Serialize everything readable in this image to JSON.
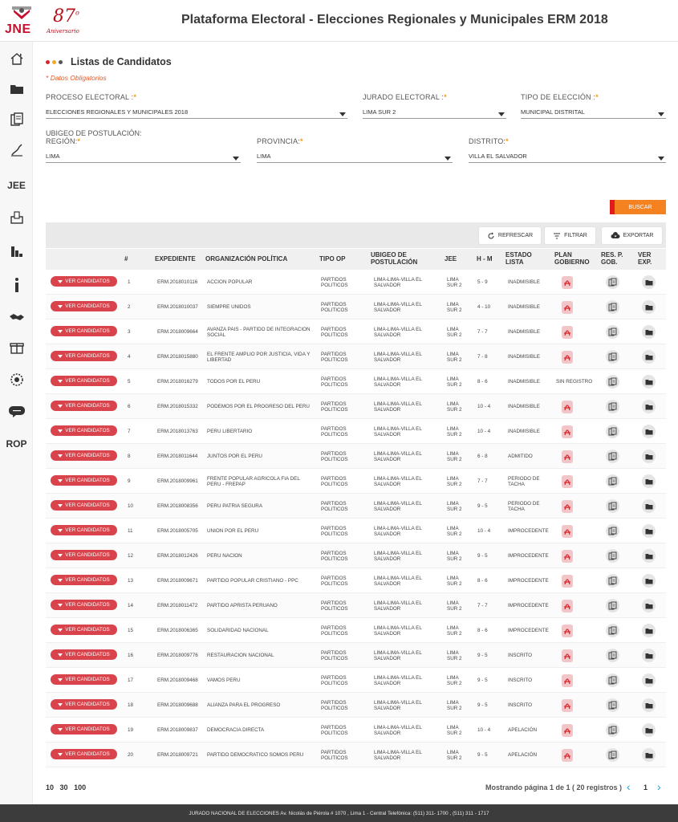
{
  "header": {
    "logo_text": "JNE",
    "anniversary_number": "87",
    "anniversary_sup": "o",
    "anniversary_text": "Aniversario",
    "title": "Plataforma Electoral - Elecciones Regionales y Municipales ERM 2018"
  },
  "sidebar": {
    "items": [
      {
        "icon": "home-icon"
      },
      {
        "icon": "folder-icon"
      },
      {
        "icon": "documents-icon"
      },
      {
        "icon": "signature-icon"
      },
      {
        "label": "JEE"
      },
      {
        "icon": "ballot-box-icon"
      },
      {
        "icon": "bar-chart-icon"
      },
      {
        "icon": "info-icon"
      },
      {
        "icon": "handshake-icon"
      },
      {
        "icon": "gift-icon"
      },
      {
        "icon": "globe-icon"
      },
      {
        "icon": "chat-icon"
      },
      {
        "label": "ROP"
      }
    ]
  },
  "page": {
    "title": "Listas de Candidatos",
    "dot_colors": [
      "#d9252a",
      "#f5a623",
      "#555555"
    ],
    "required_note": "Datos Obligatorios",
    "required_symbol": "*"
  },
  "filters": {
    "proceso": {
      "label": "PROCESO ELECTORAL :",
      "value": "ELECCIONES REGIONALES Y MUNICIPALES 2018"
    },
    "jurado": {
      "label": "JURADO ELECTORAL :",
      "value": "LIMA SUR 2"
    },
    "tipo": {
      "label": "TIPO DE ELECCIÓN :",
      "value": "MUNICIPAL DISTRITAL"
    },
    "ubigeo_heading": "UBIGEO DE POSTULACIÓN:",
    "region": {
      "label": "REGIÓN:",
      "value": "LIMA"
    },
    "provincia": {
      "label": "PROVINCIA:",
      "value": "LIMA"
    },
    "distrito": {
      "label": "DISTRITO:",
      "value": "VILLA EL SALVADOR"
    },
    "asterisk": "*"
  },
  "buttons": {
    "buscar": "BUSCAR",
    "refrescar": "REFRESCAR",
    "filtrar": "FILTRAR",
    "exportar": "EXPORTAR",
    "ver_candidatos": "VER CANDIDATOS"
  },
  "table": {
    "columns": [
      "#",
      "EXPEDIENTE",
      "ORGANIZACIÓN POLÍTICA",
      "TIPO OP",
      "UBIGEO DE POSTULACIÓN",
      "JEE",
      "H - M",
      "ESTADO LISTA",
      "PLAN GOBIERNO",
      "RES. P. GOB.",
      "VER EXP."
    ],
    "rows": [
      {
        "n": "1",
        "exp": "ERM.2018010116",
        "org": "ACCION POPULAR",
        "tipo": "PARTIDOS POLITICOS",
        "ubigeo": "LIMA-LIMA-VILLA EL SALVADOR",
        "jee": "LIMA SUR 2",
        "hm": "5 - 9",
        "estado": "INADMISIBLE",
        "plan": "pdf"
      },
      {
        "n": "2",
        "exp": "ERM.2018010037",
        "org": "SIEMPRE UNIDOS",
        "tipo": "PARTIDOS POLITICOS",
        "ubigeo": "LIMA-LIMA-VILLA EL SALVADOR",
        "jee": "LIMA SUR 2",
        "hm": "4 - 10",
        "estado": "INADMISIBLE",
        "plan": "pdf"
      },
      {
        "n": "3",
        "exp": "ERM.2018009664",
        "org": "AVANZA PAIS - PARTIDO DE INTEGRACION SOCIAL",
        "tipo": "PARTIDOS POLITICOS",
        "ubigeo": "LIMA-LIMA-VILLA EL SALVADOR",
        "jee": "LIMA SUR 2",
        "hm": "7 - 7",
        "estado": "INADMISIBLE",
        "plan": "pdf"
      },
      {
        "n": "4",
        "exp": "ERM.2018015880",
        "org": "EL FRENTE AMPLIO POR JUSTICIA, VIDA Y LIBERTAD",
        "tipo": "PARTIDOS POLITICOS",
        "ubigeo": "LIMA-LIMA-VILLA EL SALVADOR",
        "jee": "LIMA SUR 2",
        "hm": "7 - 8",
        "estado": "INADMISIBLE",
        "plan": "pdf"
      },
      {
        "n": "5",
        "exp": "ERM.2018016279",
        "org": "TODOS POR EL PERU",
        "tipo": "PARTIDOS POLITICOS",
        "ubigeo": "LIMA-LIMA-VILLA EL SALVADOR",
        "jee": "LIMA SUR 2",
        "hm": "8 - 6",
        "estado": "INADMISIBLE",
        "plan": "SIN REGISTRO"
      },
      {
        "n": "6",
        "exp": "ERM.2018015332",
        "org": "PODEMOS POR EL PROGRESO DEL PERU",
        "tipo": "PARTIDOS POLITICOS",
        "ubigeo": "LIMA-LIMA-VILLA EL SALVADOR",
        "jee": "LIMA SUR 2",
        "hm": "10 - 4",
        "estado": "INADMISIBLE",
        "plan": "pdf"
      },
      {
        "n": "7",
        "exp": "ERM.2018013763",
        "org": "PERU LIBERTARIO",
        "tipo": "PARTIDOS POLITICOS",
        "ubigeo": "LIMA-LIMA-VILLA EL SALVADOR",
        "jee": "LIMA SUR 2",
        "hm": "10 - 4",
        "estado": "INADMISIBLE",
        "plan": "pdf"
      },
      {
        "n": "8",
        "exp": "ERM.2018011644",
        "org": "JUNTOS POR EL PERU",
        "tipo": "PARTIDOS POLITICOS",
        "ubigeo": "LIMA-LIMA-VILLA EL SALVADOR",
        "jee": "LIMA SUR 2",
        "hm": "6 - 8",
        "estado": "ADMITIDO",
        "plan": "pdf"
      },
      {
        "n": "9",
        "exp": "ERM.2018009961",
        "org": "FRENTE POPULAR AGRICOLA FIA DEL PERU - FREPAP",
        "tipo": "PARTIDOS POLITICOS",
        "ubigeo": "LIMA-LIMA-VILLA EL SALVADOR",
        "jee": "LIMA SUR 2",
        "hm": "7 - 7",
        "estado": "PERIODO DE TACHA",
        "plan": "pdf"
      },
      {
        "n": "10",
        "exp": "ERM.2018008356",
        "org": "PERU PATRIA SEGURA",
        "tipo": "PARTIDOS POLITICOS",
        "ubigeo": "LIMA-LIMA-VILLA EL SALVADOR",
        "jee": "LIMA SUR 2",
        "hm": "9 - 5",
        "estado": "PERIODO DE TACHA",
        "plan": "pdf"
      },
      {
        "n": "11",
        "exp": "ERM.2018005705",
        "org": "UNION POR EL PERU",
        "tipo": "PARTIDOS POLITICOS",
        "ubigeo": "LIMA-LIMA-VILLA EL SALVADOR",
        "jee": "LIMA SUR 2",
        "hm": "10 - 4",
        "estado": "IMPROCEDENTE",
        "plan": "pdf"
      },
      {
        "n": "12",
        "exp": "ERM.2018012426",
        "org": "PERU NACION",
        "tipo": "PARTIDOS POLITICOS",
        "ubigeo": "LIMA-LIMA-VILLA EL SALVADOR",
        "jee": "LIMA SUR 2",
        "hm": "9 - 5",
        "estado": "IMPROCEDENTE",
        "plan": "pdf"
      },
      {
        "n": "13",
        "exp": "ERM.2018009671",
        "org": "PARTIDO POPULAR CRISTIANO - PPC",
        "tipo": "PARTIDOS POLITICOS",
        "ubigeo": "LIMA-LIMA-VILLA EL SALVADOR",
        "jee": "LIMA SUR 2",
        "hm": "8 - 6",
        "estado": "IMPROCEDENTE",
        "plan": "pdf"
      },
      {
        "n": "14",
        "exp": "ERM.2018011472",
        "org": "PARTIDO APRISTA PERUANO",
        "tipo": "PARTIDOS POLITICOS",
        "ubigeo": "LIMA-LIMA-VILLA EL SALVADOR",
        "jee": "LIMA SUR 2",
        "hm": "7 - 7",
        "estado": "IMPROCEDENTE",
        "plan": "pdf"
      },
      {
        "n": "15",
        "exp": "ERM.2018006365",
        "org": "SOLIDARIDAD NACIONAL",
        "tipo": "PARTIDOS POLITICOS",
        "ubigeo": "LIMA-LIMA-VILLA EL SALVADOR",
        "jee": "LIMA SUR 2",
        "hm": "8 - 6",
        "estado": "IMPROCEDENTE",
        "plan": "pdf"
      },
      {
        "n": "16",
        "exp": "ERM.2018009776",
        "org": "RESTAURACION NACIONAL",
        "tipo": "PARTIDOS POLITICOS",
        "ubigeo": "LIMA-LIMA-VILLA EL SALVADOR",
        "jee": "LIMA SUR 2",
        "hm": "9 - 5",
        "estado": "INSCRITO",
        "plan": "pdf"
      },
      {
        "n": "17",
        "exp": "ERM.2018009468",
        "org": "VAMOS PERU",
        "tipo": "PARTIDOS POLITICOS",
        "ubigeo": "LIMA-LIMA-VILLA EL SALVADOR",
        "jee": "LIMA SUR 2",
        "hm": "9 - 5",
        "estado": "INSCRITO",
        "plan": "pdf"
      },
      {
        "n": "18",
        "exp": "ERM.2018009688",
        "org": "ALIANZA PARA EL PROGRESO",
        "tipo": "PARTIDOS POLITICOS",
        "ubigeo": "LIMA-LIMA-VILLA EL SALVADOR",
        "jee": "LIMA SUR 2",
        "hm": "9 - 5",
        "estado": "INSCRITO",
        "plan": "pdf"
      },
      {
        "n": "19",
        "exp": "ERM.2018009837",
        "org": "DEMOCRACIA DIRECTA",
        "tipo": "PARTIDOS POLITICOS",
        "ubigeo": "LIMA-LIMA-VILLA EL SALVADOR",
        "jee": "LIMA SUR 2",
        "hm": "10 - 4",
        "estado": "APELACIÓN",
        "plan": "pdf"
      },
      {
        "n": "20",
        "exp": "ERM.2018009721",
        "org": "PARTIDO DEMOCRATICO SOMOS PERU",
        "tipo": "PARTIDOS POLITICOS",
        "ubigeo": "LIMA-LIMA-VILLA EL SALVADOR",
        "jee": "LIMA SUR 2",
        "hm": "9 - 5",
        "estado": "APELACIÓN",
        "plan": "pdf"
      }
    ]
  },
  "pagination": {
    "sizes": [
      "10",
      "30",
      "100"
    ],
    "info": "Mostrando página 1 de 1 ( 20 registros )",
    "current": "1",
    "prev": "‹",
    "next": "›"
  },
  "footer": {
    "text": "JURADO NACIONAL DE ELECCIONES Av. Nicolás de Piérola # 1070 , Lima 1 - Central Telefónica: (511) 311- 1700 , (511) 311 - 1717"
  },
  "colors": {
    "accent_red": "#d9434b",
    "buscar_orange": "#f58220",
    "link_blue": "#2a9fd6"
  }
}
